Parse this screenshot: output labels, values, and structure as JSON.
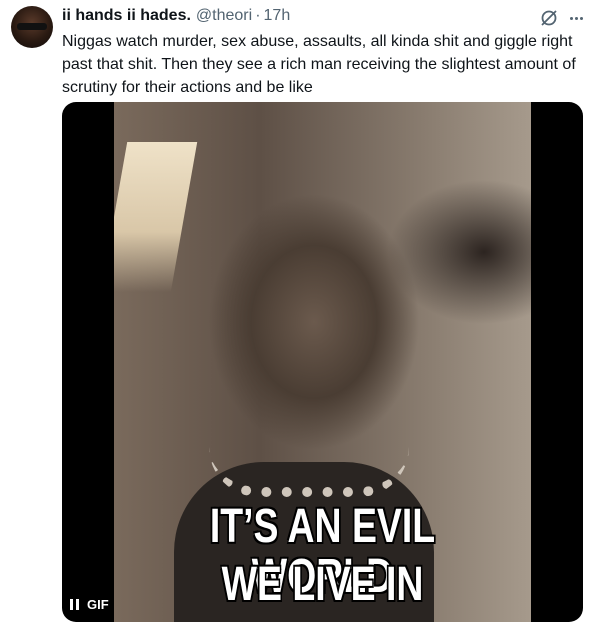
{
  "tweet": {
    "display_name": "ii hands ii hades.",
    "handle": "@theori",
    "separator": "·",
    "time": "17h",
    "text": "Niggas watch murder, sex abuse, assaults, all kinda shit and giggle right past that shit. Then they see a rich man receiving the slightest amount of scrutiny for their actions and be like"
  },
  "media": {
    "caption_line1": "IT’S AN EVIL WORLD",
    "caption_line2": "WE LIVE IN",
    "badge": "GIF"
  },
  "icons": {
    "grok": "grok-icon",
    "more": "more-icon",
    "pause": "pause-icon"
  }
}
